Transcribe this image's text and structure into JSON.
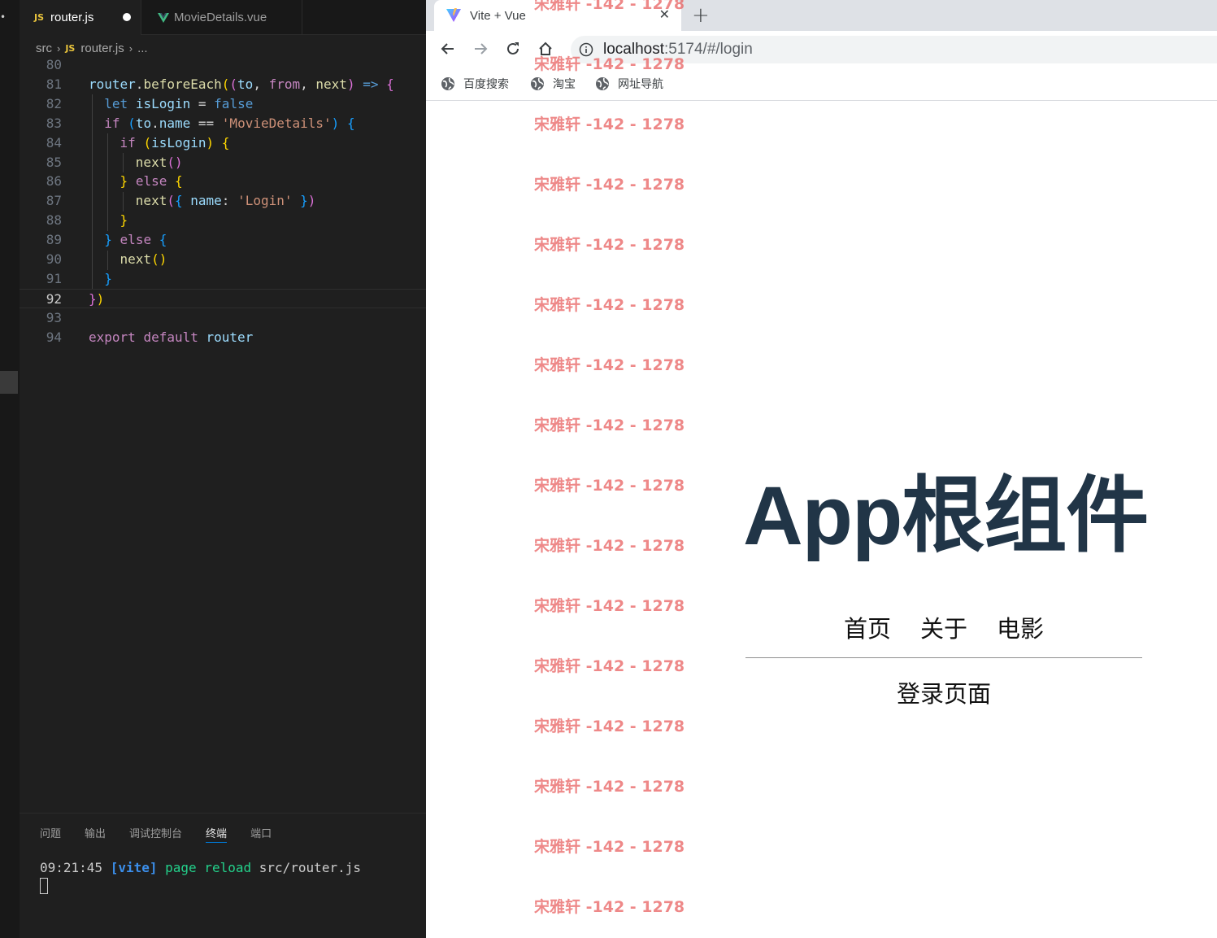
{
  "editor": {
    "tabs": [
      {
        "label": "router.js",
        "icon": "js-icon",
        "modified": true
      },
      {
        "label": "MovieDetails.vue",
        "icon": "vue-icon"
      }
    ],
    "breadcrumb": [
      "src",
      "router.js",
      "..."
    ],
    "lines": [
      {
        "n": "80",
        "code": ""
      },
      {
        "n": "81",
        "code": "router.beforeEach((to, from, next) => {"
      },
      {
        "n": "82",
        "code": "  let isLogin = false"
      },
      {
        "n": "83",
        "code": "  if (to.name == 'MovieDetails') {"
      },
      {
        "n": "84",
        "code": "    if (isLogin) {"
      },
      {
        "n": "85",
        "code": "      next()"
      },
      {
        "n": "86",
        "code": "    } else {"
      },
      {
        "n": "87",
        "code": "      next({ name: 'Login' })"
      },
      {
        "n": "88",
        "code": "    }"
      },
      {
        "n": "89",
        "code": "  } else {"
      },
      {
        "n": "90",
        "code": "    next()"
      },
      {
        "n": "91",
        "code": "  }"
      },
      {
        "n": "92",
        "code": "})"
      },
      {
        "n": "93",
        "code": ""
      },
      {
        "n": "94",
        "code": "export default router"
      }
    ],
    "current_line": "92"
  },
  "panel": {
    "tabs": [
      "问题",
      "输出",
      "调试控制台",
      "终端",
      "端口"
    ],
    "active_tab": "终端",
    "terminal": {
      "time": "09:21:45",
      "tag": "[vite]",
      "action": "page reload",
      "file": "src/router.js"
    }
  },
  "browser": {
    "tab_title": "Vite + Vue",
    "url_host": "localhost",
    "url_rest": ":5174/#/login",
    "bookmarks": [
      "百度搜索",
      "淘宝",
      "网址导航"
    ]
  },
  "app": {
    "title": "App根组件",
    "nav": [
      "首页",
      "关于",
      "电影"
    ],
    "view_text": "登录页面"
  },
  "watermark": {
    "text": "宋雅轩 -142 - 1278",
    "repeat": 16
  }
}
